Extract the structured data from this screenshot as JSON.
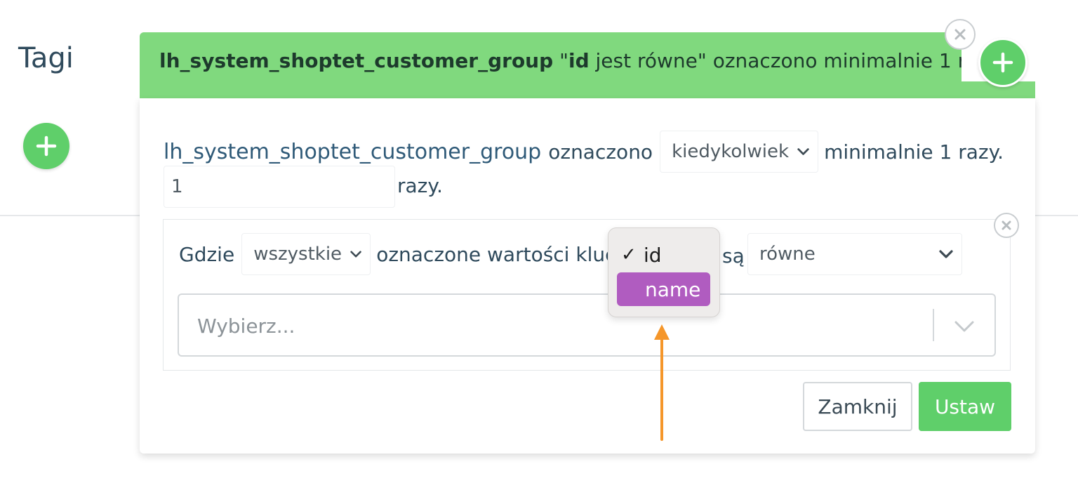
{
  "page": {
    "title": "Tagi"
  },
  "tag_header": {
    "tag_name": "lh_system_shoptet_customer_group",
    "quote_open": "\"",
    "key": "id",
    "condition_suffix": "jest równe\"",
    "tail": "oznaczono minimalnie 1 raz"
  },
  "editor": {
    "tag_name": "lh_system_shoptet_customer_group",
    "tagged_word": "oznaczono",
    "when_select": "kiedykolwiek",
    "min_text": "minimalnie 1 razy.",
    "count_value": "1",
    "count_suffix": "razy."
  },
  "condition": {
    "where_label": "Gdzie",
    "scope_select": "wszystkie",
    "keys_text": "oznaczone wartości klucza",
    "are_label": "są",
    "operator_select": "równe",
    "value_placeholder": "Wybierz...",
    "key_dropdown": {
      "options": [
        {
          "label": "id",
          "checked": true,
          "mark": "✓"
        },
        {
          "label": "name",
          "highlighted": true
        }
      ]
    }
  },
  "buttons": {
    "close": "Zamknij",
    "set": "Ustaw"
  },
  "colors": {
    "green_header": "#80d97e",
    "green_button": "#5fcf6a",
    "highlight_purple": "#b05cc0",
    "arrow_orange": "#f5962a"
  },
  "icons": [
    "plus-icon",
    "close-circle-icon",
    "chevron-down-icon",
    "check-icon",
    "arrow-up-icon"
  ]
}
